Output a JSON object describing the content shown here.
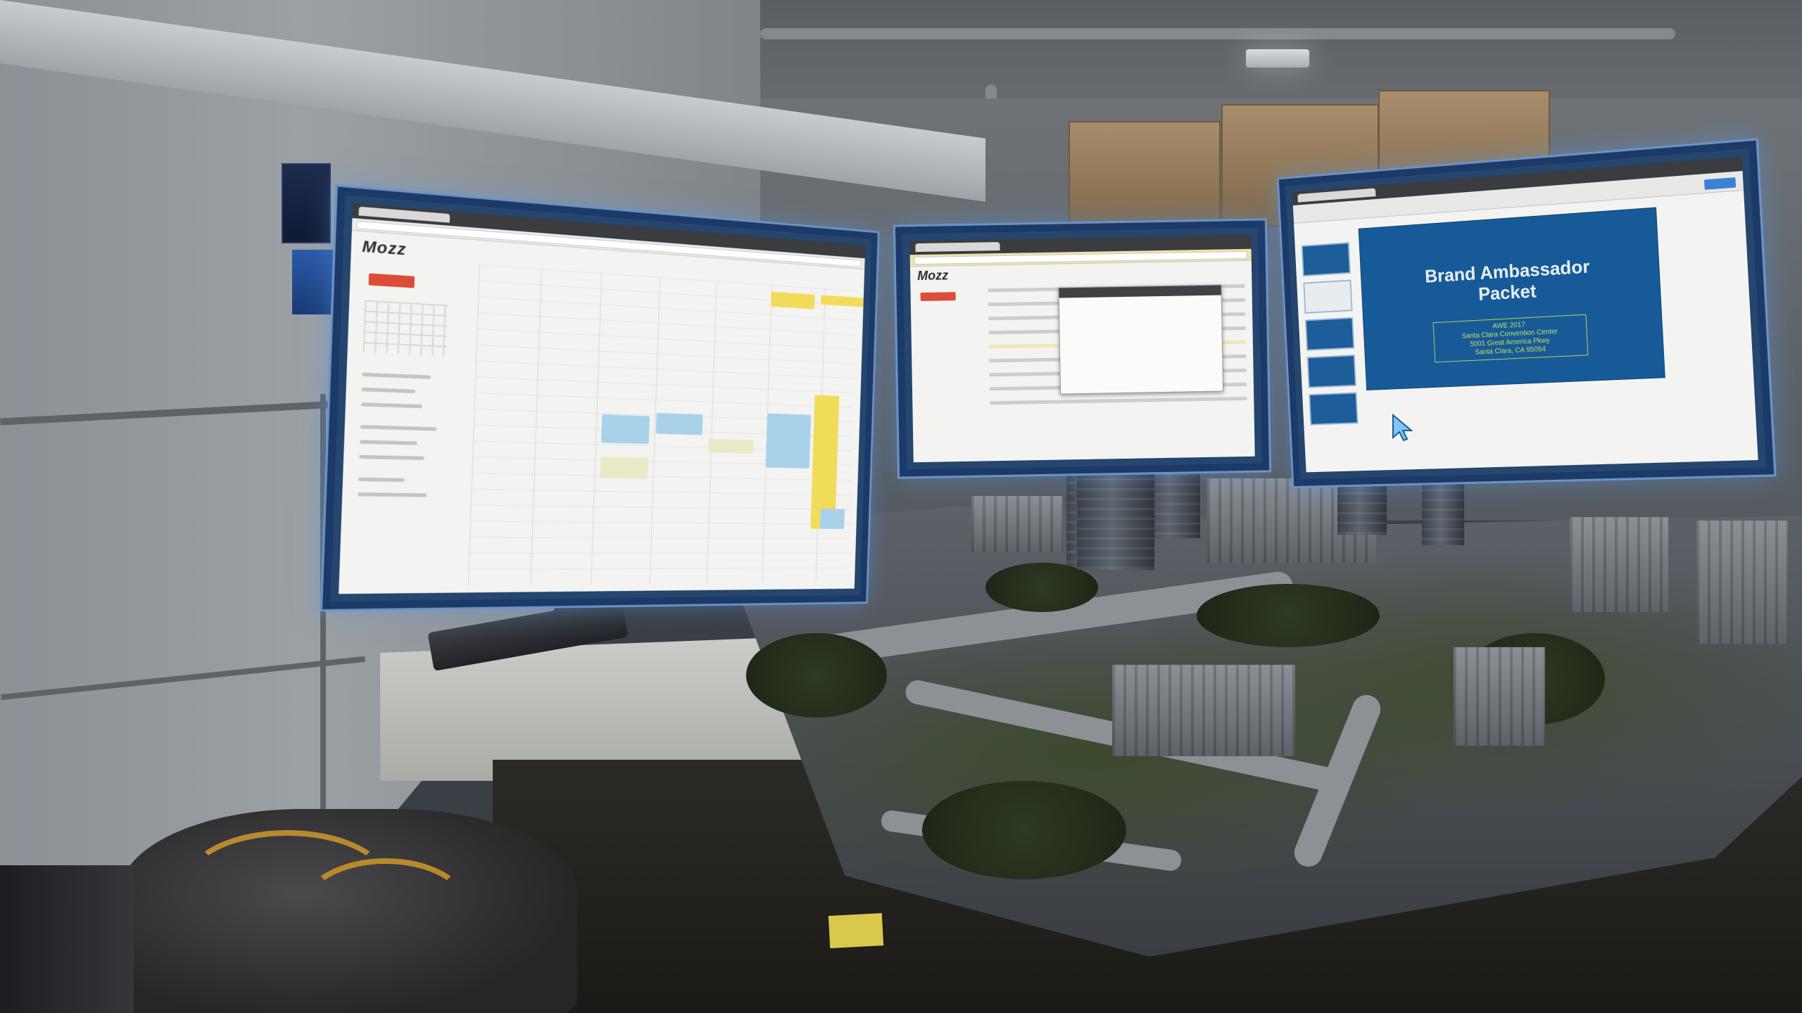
{
  "scene": {
    "description_visible": false
  },
  "monitors": {
    "left": {
      "app": "calendar",
      "logo_text": "Mozz",
      "icon": "calendar-app-icon"
    },
    "middle": {
      "app": "mail",
      "logo_text": "Mozz",
      "icon": "mail-app-icon"
    },
    "right": {
      "app": "slides",
      "slide_title": "Brand Ambassador\nPacket",
      "slide_subtitle": "AWE 2017\nSanta Clara Convention Center\n5001 Great America Pkwy\nSanta Clara, CA 95054",
      "icon": "slides-app-icon"
    }
  },
  "cursor": {
    "icon": "pointer-cursor-icon"
  },
  "colors": {
    "frame": "#1b3a68",
    "frame_glow": "#6b93c4",
    "slide_bg": "#165a98",
    "accent_red": "#dd4b39",
    "event_yellow": "#f1dc5a",
    "event_blue": "#a9d2ea"
  }
}
